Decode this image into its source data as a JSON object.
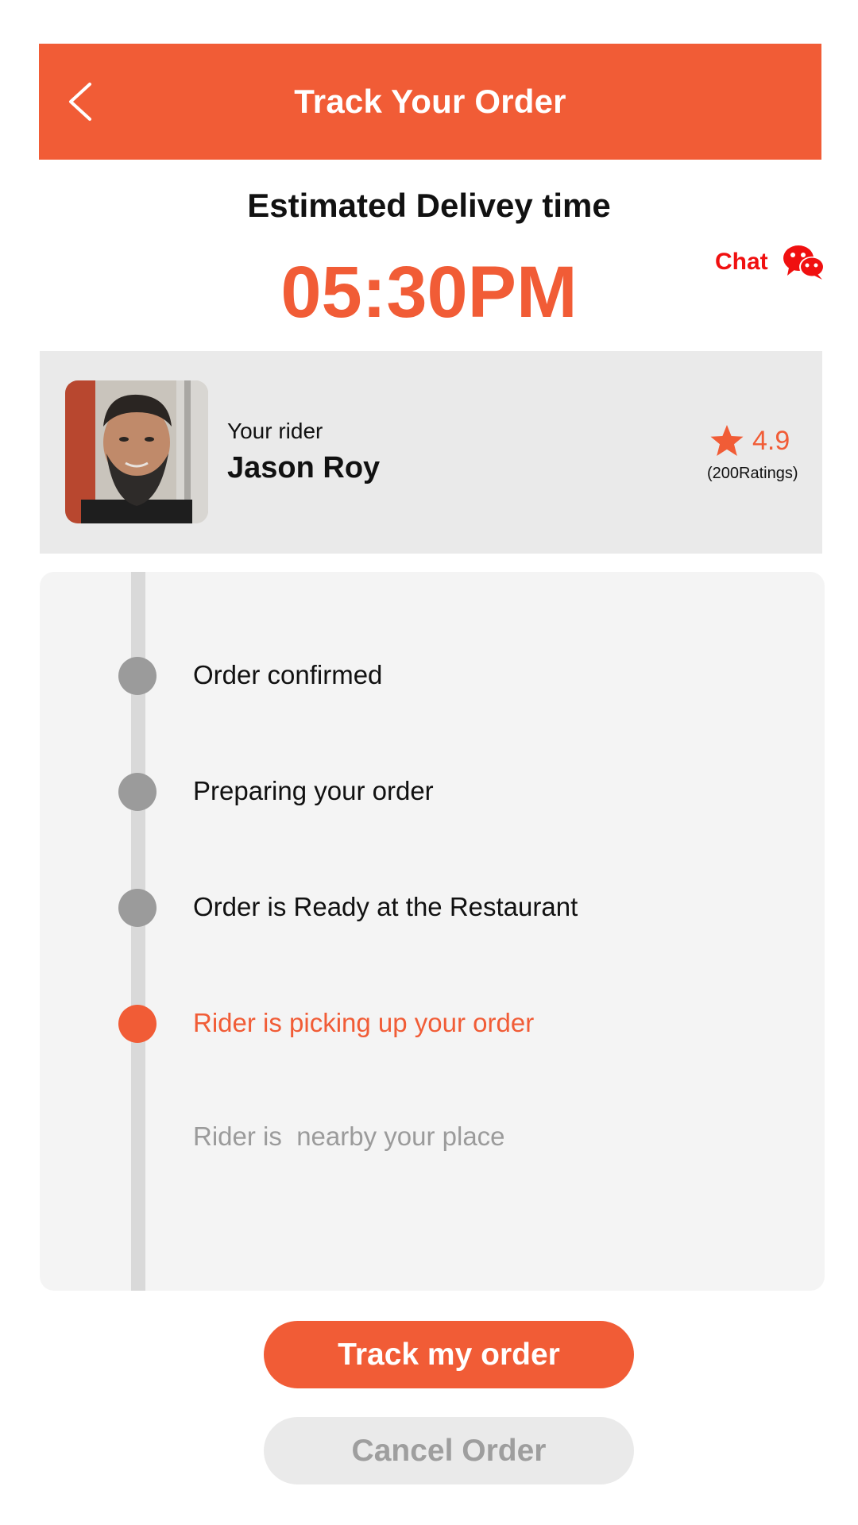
{
  "header": {
    "title": "Track Your Order",
    "back_icon": "chevron-left-icon"
  },
  "eta": {
    "label": "Estimated Delivey time",
    "time": "05:30PM"
  },
  "chat": {
    "label": "Chat",
    "icon": "chat-bubbles-icon"
  },
  "rider": {
    "subtitle": "Your rider",
    "name": "Jason Roy",
    "rating": "4.9",
    "ratings_count": "(200Ratings)",
    "rating_icon": "star-icon"
  },
  "timeline": {
    "steps": [
      {
        "label": "Order confirmed",
        "status": "done"
      },
      {
        "label": "Preparing your order",
        "status": "done"
      },
      {
        "label": "Order is Ready at the Restaurant",
        "status": "done"
      },
      {
        "label": "Rider is picking up your order",
        "status": "active"
      },
      {
        "label": "Rider is  nearby your place",
        "status": "pending"
      }
    ]
  },
  "actions": {
    "track_label": "Track my order",
    "cancel_label": "Cancel Order"
  },
  "colors": {
    "accent": "#F15C36",
    "chat_red": "#F01010",
    "done_dot": "#9B9B9B",
    "card_bg": "#EAEAEA",
    "timeline_bg": "#F4F4F4"
  }
}
